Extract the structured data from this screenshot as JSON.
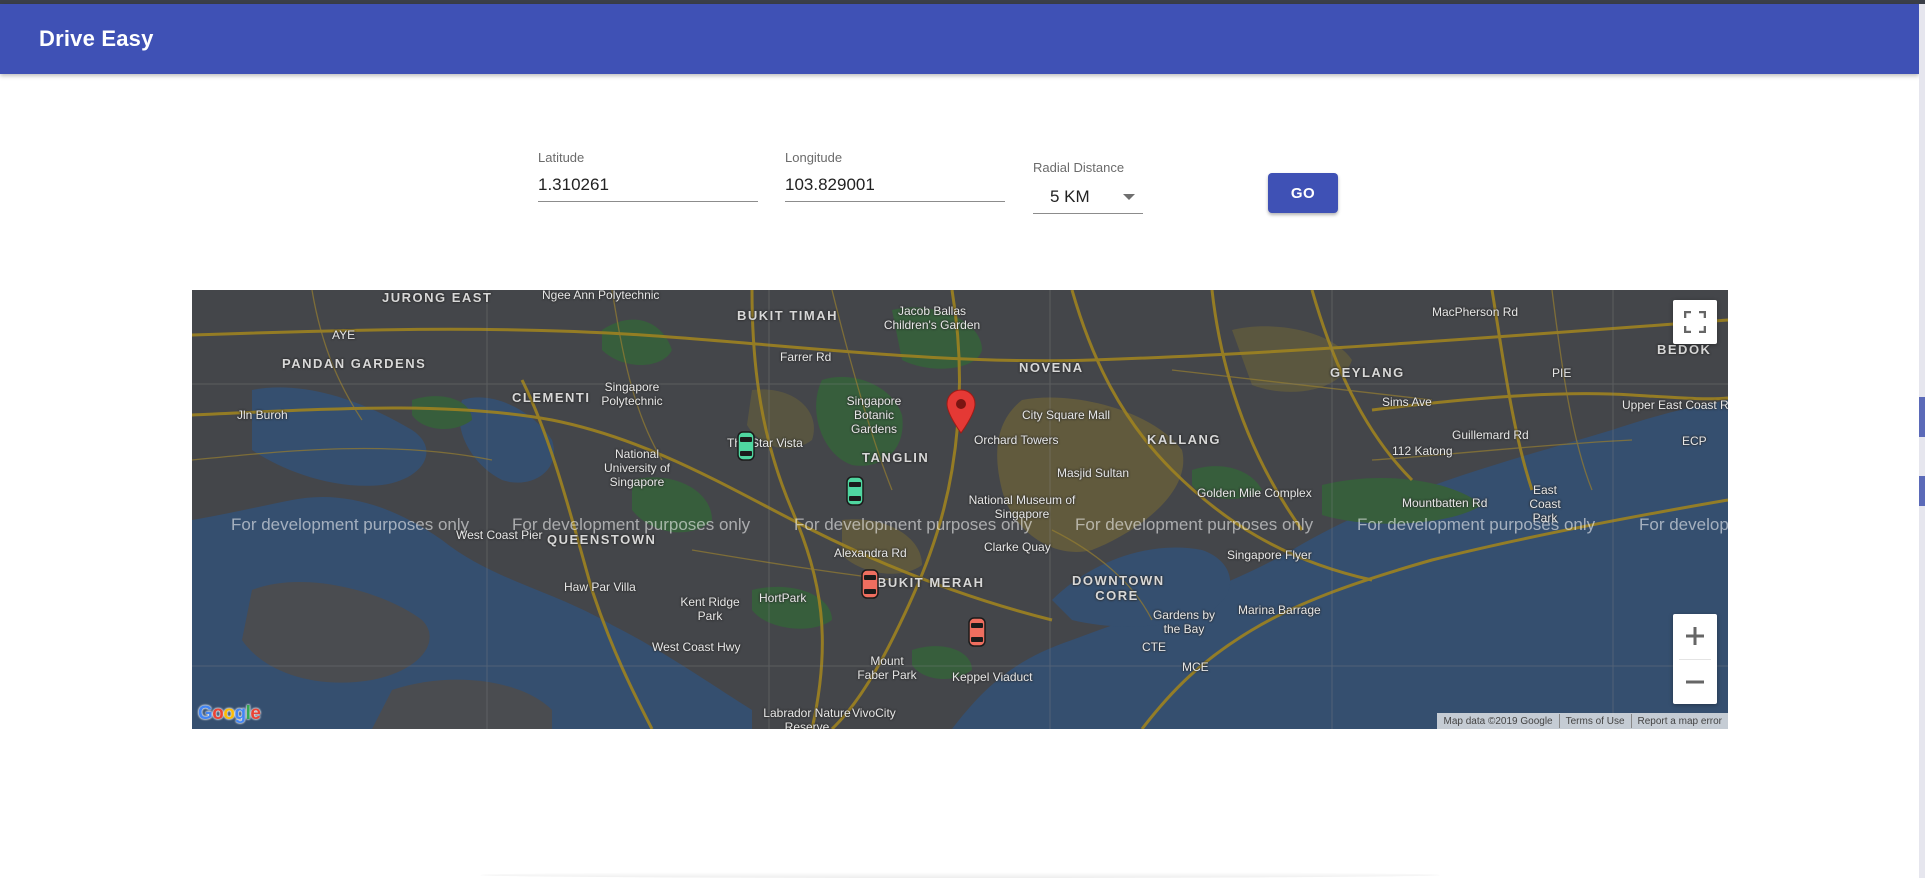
{
  "app": {
    "title": "Drive Easy",
    "brand_color": "#3f51b5"
  },
  "form": {
    "latitude": {
      "label": "Latitude",
      "value": "1.310261"
    },
    "longitude": {
      "label": "Longitude",
      "value": "103.829001"
    },
    "radial_distance": {
      "label": "Radial Distance",
      "selected": "5 KM"
    },
    "go_label": "GO"
  },
  "map": {
    "watermark": "For development purposes only",
    "watermark_partial": "For develop",
    "attribution": {
      "map_data": "Map data ©2019 Google",
      "terms": "Terms of Use",
      "report": "Report a map error"
    },
    "logo_text": "Google",
    "labels": [
      "JURONG EAST",
      "Ngee Ann Polytechnic",
      "BUKIT TIMAH",
      "Jacob Ballas Children's Garden",
      "PANDAN GARDENS",
      "CLEMENTI",
      "Singapore Polytechnic",
      "Singapore Botanic Gardens",
      "NOVENA",
      "City Square Mall",
      "GEYLANG",
      "BEDOK",
      "Jln Buroh",
      "AYE",
      "The Star Vista",
      "National University of Singapore",
      "TANGLIN",
      "Orchard Towers",
      "KALLANG",
      "112 Katong",
      "Masjid Sultan",
      "Golden Mile Complex",
      "National Museum of Singapore",
      "QUEENSTOWN",
      "Clarke Quay",
      "Singapore Flyer",
      "East Coast Park",
      "Haw Par Villa",
      "Kent Ridge Park",
      "HortPark",
      "BUKIT MERAH",
      "DOWNTOWN CORE",
      "Gardens by the Bay",
      "Marina Barrage",
      "Mount Faber Park",
      "Keppel Viaduct",
      "Labrador Nature Reserve",
      "VivoCity",
      "Sims Ave",
      "PIE",
      "CTE",
      "ECP",
      "West Coast Pier",
      "West Coast Hwy",
      "Alexandra Rd",
      "Upper East Coast Rd",
      "Guillemard Rd",
      "Mountbatten Rd",
      "MCE",
      "Farrer Rd",
      "MacPherson Rd"
    ],
    "vehicles": [
      {
        "status": "available",
        "color": "#4fd6a0"
      },
      {
        "status": "available",
        "color": "#4fd6a0"
      },
      {
        "status": "busy",
        "color": "#ef6e5f"
      },
      {
        "status": "busy",
        "color": "#ef6e5f"
      }
    ],
    "marker_color": "#e53935"
  }
}
